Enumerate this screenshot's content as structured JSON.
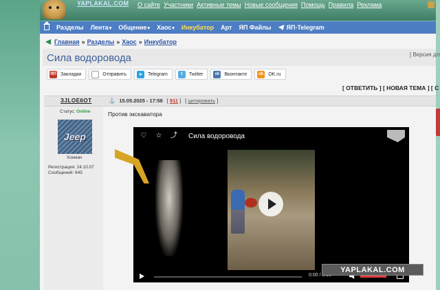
{
  "header": {
    "logo_text": "YAPLAKAL.COM",
    "top_links": [
      "О сайте",
      "Участники",
      "Активные темы",
      "Новые сообщения",
      "Помощь",
      "Правила",
      "Реклама"
    ]
  },
  "nav": {
    "items": [
      {
        "label": "Разделы",
        "caret": false
      },
      {
        "label": "Лента",
        "caret": true
      },
      {
        "label": "Общение",
        "caret": true
      },
      {
        "label": "Хаос",
        "caret": true
      },
      {
        "label": "Инкубатор",
        "caret": false,
        "highlight": true
      },
      {
        "label": "Арт",
        "caret": false
      },
      {
        "label": "ЯП Файлы",
        "caret": false
      },
      {
        "label": "ЯП-Telegram",
        "caret": false
      }
    ],
    "highlight_color": "#ffe14a"
  },
  "breadcrumb": [
    "Главная",
    "Разделы",
    "Хаос",
    "Инкубатор"
  ],
  "page": {
    "title": "Сила водоровода",
    "version_link": "[ Версия для"
  },
  "share": [
    {
      "label": "Закладки",
      "icon": "yap-icon"
    },
    {
      "label": "Отправить",
      "icon": "mail-icon"
    },
    {
      "label": "Telegram",
      "icon": "telegram-icon"
    },
    {
      "label": "Twitter",
      "icon": "twitter-icon"
    },
    {
      "label": "Вконтакте",
      "icon": "vk-icon"
    },
    {
      "label": "OK.ru",
      "icon": "ok-icon"
    }
  ],
  "actions": {
    "reply": "[ ОТВЕТИТЬ ]",
    "new_topic": "[ НОВАЯ ТЕМА ]",
    "more": "[ С"
  },
  "post": {
    "author": "ЗJLOE6OT",
    "date": "15.05.2025 - 17:58",
    "rating": "911",
    "quote": "цитировать",
    "status_label": "Статус:",
    "status_value": "Online",
    "avatar_text": "Jeep",
    "user_title": "Хохмач",
    "registration": "Регистрация: 24.10.07",
    "messages": "Сообщений: 645",
    "text": "Против экскаватора"
  },
  "video": {
    "title": "Сила водоровода",
    "current_time": "0:00",
    "duration": "0:16",
    "accent": "#e23b3b"
  },
  "watermark": "YAPLAKAL.COM"
}
